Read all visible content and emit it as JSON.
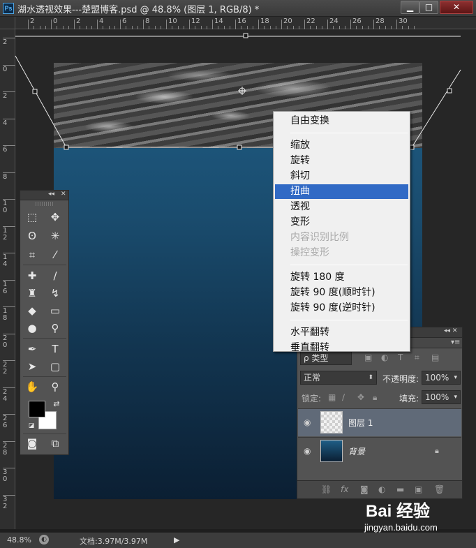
{
  "window": {
    "title": "湖水透视效果---楚盟博客.psd @ 48.8% (图层 1, RGB/8) *",
    "app_icon": "Ps",
    "minimize": "▁",
    "maximize": "□",
    "close": "✕"
  },
  "ruler_top": [
    "2",
    "0",
    "2",
    "4",
    "6",
    "8",
    "10",
    "12",
    "14",
    "16",
    "18",
    "20",
    "22",
    "24",
    "26",
    "28",
    "30"
  ],
  "ruler_left": [
    "2",
    "0",
    "2",
    "4",
    "6",
    "8",
    "1 0",
    "1 2",
    "1 4",
    "1 6",
    "1 8",
    "2 0",
    "2 2",
    "2 4",
    "2 6",
    "2 8",
    "3 0",
    "3 2"
  ],
  "context_menu": {
    "items": [
      {
        "label": "自由变换",
        "state": "normal"
      },
      {
        "label": "缩放",
        "state": "normal"
      },
      {
        "label": "旋转",
        "state": "normal"
      },
      {
        "label": "斜切",
        "state": "normal"
      },
      {
        "label": "扭曲",
        "state": "highlighted"
      },
      {
        "label": "透视",
        "state": "normal"
      },
      {
        "label": "变形",
        "state": "normal"
      },
      {
        "label": "内容识别比例",
        "state": "disabled"
      },
      {
        "label": "操控变形",
        "state": "disabled"
      },
      {
        "label": "旋转 180 度",
        "state": "normal"
      },
      {
        "label": "旋转 90 度(顺时针)",
        "state": "normal"
      },
      {
        "label": "旋转 90 度(逆时针)",
        "state": "normal"
      },
      {
        "label": "水平翻转",
        "state": "normal"
      },
      {
        "label": "垂直翻转",
        "state": "normal"
      }
    ]
  },
  "tools_panel": {
    "collapse": "◂◂",
    "close": "✕"
  },
  "layers_panel": {
    "filter_kind": "ρ 类型",
    "blend_mode": "正常",
    "opacity_label": "不透明度:",
    "opacity_value": "100%",
    "lock_label": "锁定:",
    "fill_label": "填充:",
    "fill_value": "100%",
    "layers": [
      {
        "name": "图层 1",
        "selected": true,
        "visible": true
      },
      {
        "name": "背景",
        "selected": false,
        "visible": true,
        "locked": true
      }
    ]
  },
  "status_bar": {
    "zoom": "48.8%",
    "doc_info": "文档:3.97M/3.97M"
  },
  "watermark": {
    "brand": "Bai 经验",
    "url": "jingyan.baidu.com"
  },
  "colors": {
    "menu_highlight": "#316ac5",
    "selected_layer": "#606a78",
    "water_blue_top": "#1f5e86",
    "water_blue_bottom": "#0b1f33"
  }
}
